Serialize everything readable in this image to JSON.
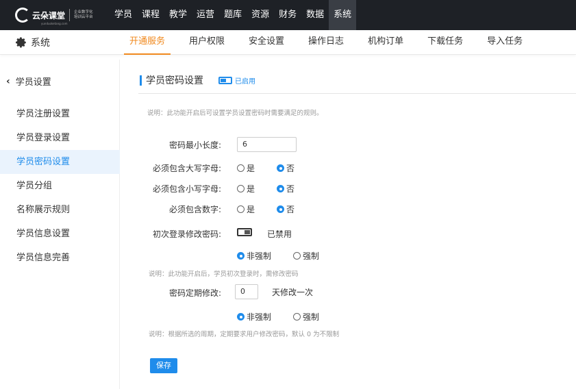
{
  "brand": {
    "name": "云朵课堂",
    "tagline_1": "企业数字化",
    "tagline_2": "培训云平台",
    "url": "yunduoketang.com"
  },
  "nav": {
    "items": [
      "学员",
      "课程",
      "教学",
      "运营",
      "题库",
      "资源",
      "财务",
      "数据",
      "系统"
    ],
    "active": "系统"
  },
  "subbar": {
    "section": "系统",
    "tabs": [
      "开通服务",
      "用户权限",
      "安全设置",
      "操作日志",
      "机构订单",
      "下载任务",
      "导入任务"
    ],
    "active": "开通服务"
  },
  "sidebar": {
    "back_label": "学员设置",
    "items": [
      "学员注册设置",
      "学员登录设置",
      "学员密码设置",
      "学员分组",
      "名称展示规则",
      "学员信息设置",
      "学员信息完善"
    ],
    "active": "学员密码设置"
  },
  "main": {
    "title": "学员密码设置",
    "enabled_label": "已启用",
    "intro_note": "说明：此功能开启后可设置学员设置密码时需要满足的规则。",
    "min_length": {
      "label": "密码最小长度:",
      "value": "6"
    },
    "uppercase": {
      "label": "必须包含大写字母:",
      "yes": "是",
      "no": "否",
      "selected": "否"
    },
    "lowercase": {
      "label": "必须包含小写字母:",
      "yes": "是",
      "no": "否",
      "selected": "否"
    },
    "digits": {
      "label": "必须包含数字:",
      "yes": "是",
      "no": "否",
      "selected": "否"
    },
    "first_login": {
      "label": "初次登录修改密码:",
      "status": "已禁用",
      "opt_soft": "非强制",
      "opt_force": "强制",
      "selected": "非强制",
      "note": "说明：此功能开启后，学员初次登录时，需修改密码"
    },
    "periodic": {
      "label": "密码定期修改:",
      "value": "0",
      "suffix": "天修改一次",
      "opt_soft": "非强制",
      "opt_force": "强制",
      "selected": "非强制",
      "note": "说明：根据所选的周期，定期要求用户修改密码，默认 0 为不限制"
    },
    "save_label": "保存"
  },
  "colors": {
    "accent": "#1f8ceb",
    "tab_active": "#f0891e",
    "topbar": "#1e2126"
  }
}
